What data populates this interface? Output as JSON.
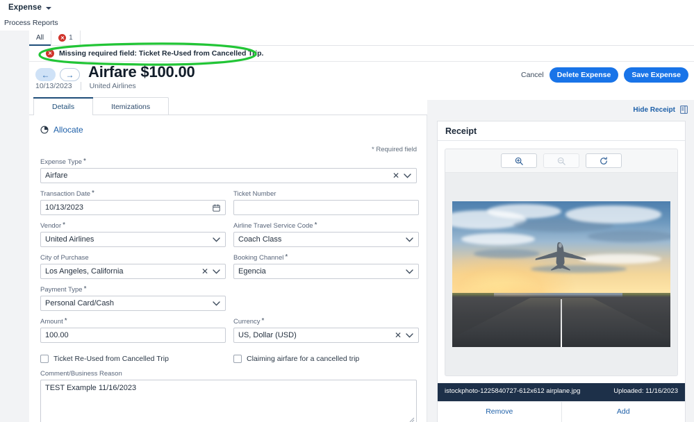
{
  "appbar": {
    "title": "Expense",
    "caret_icon": "chevron-down-icon"
  },
  "breadcrumb": {
    "text": "Process Reports"
  },
  "filter_chips": {
    "all_label": "All",
    "error_count": "1",
    "error_icon": "error-circle-icon"
  },
  "alert": {
    "icon": "error-circle-icon",
    "message": "Missing required field: Ticket Re-Used from Cancelled Trip.",
    "annotation_color": "#22c536"
  },
  "title_area": {
    "back_icon": "arrow-left-icon",
    "forward_icon": "arrow-right-icon",
    "title": "Airfare $100.00",
    "date": "10/13/2023",
    "vendor": "United Airlines",
    "cancel_label": "Cancel",
    "delete_label": "Delete Expense",
    "save_label": "Save Expense",
    "primary_color": "#1974e8"
  },
  "tabs": [
    {
      "label": "Details",
      "active": true
    },
    {
      "label": "Itemizations",
      "active": false
    }
  ],
  "form": {
    "allocate_label": "Allocate",
    "allocate_icon": "pie-chart-icon",
    "required_note": "* Required field",
    "fields": [
      {
        "label": "Expense Type",
        "required": true,
        "value": "Airfare",
        "full_width": true,
        "icons": [
          "clear-icon",
          "chevron-down-icon"
        ]
      },
      {
        "label": "Transaction Date",
        "required": true,
        "value": "10/13/2023",
        "full_width": false,
        "icons": [
          "calendar-icon"
        ]
      },
      {
        "label": "Ticket Number",
        "required": false,
        "value": "",
        "full_width": false,
        "icons": []
      },
      {
        "label": "Vendor",
        "required": true,
        "value": "United Airlines",
        "full_width": false,
        "icons": [
          "chevron-down-icon"
        ]
      },
      {
        "label": "Airline Travel Service Code",
        "required": true,
        "value": "Coach Class",
        "full_width": false,
        "icons": [
          "chevron-down-icon"
        ]
      },
      {
        "label": "City of Purchase",
        "required": false,
        "value": "Los Angeles, California",
        "full_width": false,
        "icons": [
          "clear-icon",
          "chevron-down-icon"
        ]
      },
      {
        "label": "Booking Channel",
        "required": true,
        "value": "Egencia",
        "full_width": false,
        "icons": [
          "chevron-down-icon"
        ]
      },
      {
        "label": "Payment Type",
        "required": true,
        "value": "Personal Card/Cash",
        "full_width": false,
        "icons": [
          "chevron-down-icon"
        ]
      },
      {
        "label": "",
        "required": false,
        "value": "",
        "full_width": false,
        "spacer": true,
        "icons": []
      },
      {
        "label": "Amount",
        "required": true,
        "value": "100.00",
        "full_width": false,
        "icons": []
      },
      {
        "label": "Currency",
        "required": true,
        "value": "US, Dollar (USD)",
        "full_width": false,
        "icons": [
          "clear-icon",
          "chevron-down-icon"
        ]
      }
    ],
    "checkboxes": [
      {
        "label": "Ticket Re-Used from Cancelled Trip",
        "checked": false
      },
      {
        "label": "Claiming airfare for a cancelled trip",
        "checked": false
      }
    ],
    "comment": {
      "label": "Comment/Business Reason",
      "value": "TEST Example 11/16/2023",
      "placeholder": ""
    }
  },
  "receipt": {
    "hide_label": "Hide Receipt",
    "hide_icon": "receipt-panel-icon",
    "panel_title": "Receipt",
    "toolbar": [
      {
        "name": "zoom-in-icon",
        "disabled": false
      },
      {
        "name": "zoom-out-icon",
        "disabled": true
      },
      {
        "name": "rotate-icon",
        "disabled": false
      }
    ],
    "image_alt": "airplane taking off from runway at sunset",
    "file_name": "istockphoto-1225840727-612x612 airplane.jpg",
    "uploaded_label": "Uploaded: 11/16/2023",
    "actions": [
      {
        "label": "Remove"
      },
      {
        "label": "Add"
      }
    ]
  }
}
